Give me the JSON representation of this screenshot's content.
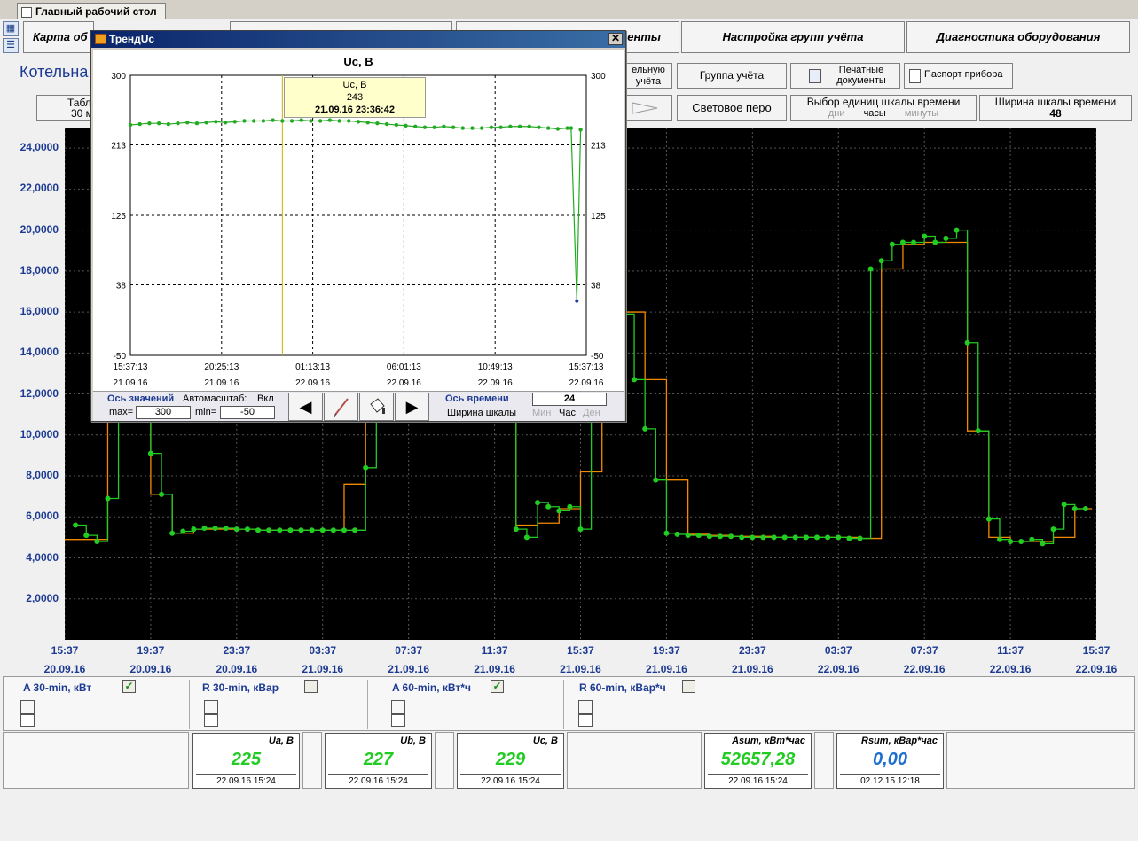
{
  "tab": {
    "title": "Главный рабочий стол"
  },
  "sidebar_icons": [
    "grid-icon",
    "list-icon"
  ],
  "top_buttons": [
    "Карта об",
    "",
    "енты",
    "Настройка групп учёта",
    "Диагностика оборудования"
  ],
  "second_row": {
    "left_partial": "ельную",
    "left_partial2": "учёта",
    "group_btn": "Группа учёта",
    "print_btn": "Печатные документы",
    "passport_btn": "Паспорт прибора"
  },
  "third_row": {
    "table_btn": "Табл",
    "table_btn_sub": "30 м",
    "pen_btn": "Световое перо",
    "units_title": "Выбор единиц шкалы времени",
    "units_days": "дни",
    "units_hours": "часы",
    "units_minutes": "минуты",
    "width_title": "Ширина шкалы времени",
    "width_value": "48"
  },
  "boiler_label": "Котельна",
  "colors": {
    "green": "#22cc22",
    "red": "#ee1111",
    "orange": "#f28a00",
    "cyan": "#22e5ee",
    "accent_blue": "#1c3a92"
  },
  "chart_data": [
    {
      "type": "line",
      "y_ticks": [
        "24,0000",
        "22,0000",
        "20,0000",
        "18,0000",
        "16,0000",
        "14,0000",
        "12,0000",
        "10,0000",
        "8,0000",
        "6,0000",
        "4,0000",
        "2,0000"
      ],
      "ylim": [
        0,
        25000
      ],
      "x_ticks": [
        {
          "time": "15:37",
          "date": "20.09.16"
        },
        {
          "time": "19:37",
          "date": "20.09.16"
        },
        {
          "time": "23:37",
          "date": "20.09.16"
        },
        {
          "time": "03:37",
          "date": "21.09.16"
        },
        {
          "time": "07:37",
          "date": "21.09.16"
        },
        {
          "time": "11:37",
          "date": "21.09.16"
        },
        {
          "time": "15:37",
          "date": "21.09.16"
        },
        {
          "time": "19:37",
          "date": "21.09.16"
        },
        {
          "time": "23:37",
          "date": "21.09.16"
        },
        {
          "time": "03:37",
          "date": "22.09.16"
        },
        {
          "time": "07:37",
          "date": "22.09.16"
        },
        {
          "time": "11:37",
          "date": "22.09.16"
        },
        {
          "time": "15:37",
          "date": "22.09.16"
        }
      ],
      "xlim": [
        0,
        48
      ],
      "grid": true,
      "series": [
        {
          "name": "A 30-min, кВт",
          "color": "#22cc22",
          "x": [
            0.5,
            1.0,
            1.5,
            2.0,
            2.5,
            3.5,
            4.0,
            4.5,
            5.0,
            5.5,
            6.0,
            6.5,
            7.0,
            7.5,
            8.0,
            8.5,
            9.0,
            9.5,
            10.0,
            10.5,
            11.0,
            11.5,
            12.0,
            12.5,
            13.0,
            13.5,
            14.0,
            14.5,
            20.5,
            21.0,
            21.5,
            22.0,
            22.5,
            23.0,
            23.5,
            24.0,
            24.5,
            25.5,
            26.0,
            26.5,
            27.0,
            27.5,
            28.0,
            28.5,
            29.0,
            29.5,
            30.0,
            30.5,
            31.0,
            31.5,
            32.0,
            32.5,
            33.0,
            33.5,
            34.0,
            34.5,
            35.0,
            35.5,
            36.0,
            36.5,
            37.0,
            37.5,
            38.0,
            38.5,
            39.0,
            39.5,
            40.0,
            40.5,
            41.0,
            41.5,
            42.0,
            42.5,
            43.0,
            43.5,
            44.0,
            44.5,
            45.0,
            45.5,
            46.0,
            46.5,
            47.0,
            47.5
          ],
          "values": [
            5600,
            5100,
            4800,
            6900,
            13000,
            13500,
            9100,
            7100,
            5200,
            5300,
            5400,
            5450,
            5450,
            5450,
            5400,
            5400,
            5350,
            5350,
            5350,
            5350,
            5350,
            5350,
            5350,
            5350,
            5350,
            5350,
            8400,
            11500,
            12100,
            5400,
            5000,
            6700,
            6500,
            6300,
            6500,
            5400,
            12000,
            19200,
            15900,
            12700,
            10300,
            7800,
            5200,
            5150,
            5100,
            5100,
            5050,
            5050,
            5050,
            5000,
            5000,
            5000,
            5000,
            5000,
            5000,
            5000,
            5000,
            5000,
            5000,
            4950,
            4950,
            18100,
            18500,
            19300,
            19400,
            19400,
            19700,
            19400,
            19600,
            20000,
            14500,
            10200,
            5900,
            4900,
            4800,
            4800,
            4900,
            4700,
            5400,
            6600,
            6400,
            6400
          ]
        },
        {
          "name": "A 60-min, кВт*ч",
          "color": "#f28a00",
          "x": [
            0.0,
            1.0,
            2.0,
            3.0,
            3.5,
            4.0,
            5.0,
            6.0,
            7.0,
            8.0,
            9.0,
            10.0,
            11.0,
            12.0,
            13.0,
            14.0,
            15.0,
            20.5,
            21.0,
            22.0,
            23.0,
            24.0,
            25.0,
            26.0,
            27.0,
            28.0,
            29.0,
            30.0,
            31.0,
            32.0,
            33.0,
            34.0,
            35.0,
            36.0,
            37.0,
            38.0,
            39.0,
            40.0,
            41.0,
            42.0,
            43.0,
            44.0,
            45.0,
            46.0,
            47.0,
            47.8
          ],
          "values": [
            4900,
            4900,
            11000,
            13000,
            13500,
            7100,
            5200,
            5400,
            5400,
            5400,
            5350,
            5350,
            5350,
            5350,
            7600,
            11500,
            12000,
            11500,
            5600,
            5700,
            6400,
            8200,
            12000,
            16000,
            12700,
            7800,
            5150,
            5100,
            5050,
            5050,
            5000,
            5000,
            5000,
            5000,
            4950,
            18100,
            19300,
            19400,
            19400,
            10200,
            5000,
            4800,
            4800,
            5000,
            6400,
            6400
          ]
        }
      ]
    },
    {
      "type": "line",
      "title": "Uc, В",
      "y_ticks": [
        "300",
        "213",
        "125",
        "38",
        "-50"
      ],
      "ylim": [
        -50,
        300
      ],
      "x_ticks": [
        {
          "time": "15:37:13",
          "date": "21.09.16"
        },
        {
          "time": "20:25:13",
          "date": "21.09.16"
        },
        {
          "time": "01:13:13",
          "date": "22.09.16"
        },
        {
          "time": "06:01:13",
          "date": "22.09.16"
        },
        {
          "time": "10:49:13",
          "date": "22.09.16"
        },
        {
          "time": "15:37:13",
          "date": "22.09.16"
        }
      ],
      "xlim": [
        0,
        24
      ],
      "grid": true,
      "series": [
        {
          "name": "Uc, В",
          "color": "#22aa22",
          "x": [
            0,
            0.5,
            1,
            1.5,
            2,
            2.5,
            3,
            3.5,
            4,
            4.5,
            5,
            5.5,
            6,
            6.5,
            7,
            7.5,
            8,
            8.5,
            9,
            9.5,
            10,
            10.5,
            11,
            11.5,
            12,
            12.5,
            13,
            13.5,
            14,
            14.5,
            15,
            15.5,
            16,
            16.5,
            17,
            17.5,
            18,
            18.5,
            19,
            19.5,
            20,
            20.5,
            21,
            21.5,
            22,
            22.5,
            23,
            23.2,
            23.5,
            23.7
          ],
          "values": [
            238,
            239,
            240,
            240,
            239,
            240,
            241,
            240,
            241,
            242,
            241,
            242,
            243,
            243,
            243,
            244,
            243,
            243,
            244,
            243,
            243,
            244,
            243,
            243,
            242,
            241,
            240,
            239,
            238,
            237,
            236,
            235,
            235,
            236,
            235,
            234,
            234,
            234,
            235,
            235,
            236,
            236,
            236,
            235,
            234,
            233,
            234,
            234,
            18,
            232
          ]
        }
      ],
      "tooltip": {
        "label": "Uc, В",
        "value": "243",
        "datetime": "21.09.16 23:36:42"
      }
    }
  ],
  "trend_window": {
    "title": "ТрендUc",
    "close": "✕",
    "ctrl": {
      "axis_values": "Ось значений",
      "autoscale": "Автомасштаб:",
      "autoscale_val": "Вкл",
      "max_label": "max=",
      "max_val": "300",
      "min_label": "min=",
      "min_val": "-50",
      "prev": "◀",
      "next": "▶",
      "axis_time": "Ось времени",
      "scale_width_label": "Ширина шкалы",
      "scale_width_val": "24",
      "u_min": "Мин",
      "u_hour": "Час",
      "u_day": "Ден"
    }
  },
  "legend": [
    {
      "name": "A 30-min, кВт",
      "checked": true,
      "check_mark": "✓",
      "color": "#22cc22"
    },
    {
      "name": "R 30-min, кВар",
      "checked": false,
      "check_mark": "",
      "color": "#ee1111"
    },
    {
      "name": "A 60-min, кВт*ч",
      "checked": true,
      "check_mark": "✓",
      "color": "#f28a00"
    },
    {
      "name": "R 60-min, кВар*ч",
      "checked": false,
      "check_mark": "",
      "color": "#22e5ee"
    }
  ],
  "values": [
    {
      "title": "Ua, В",
      "value": "225",
      "date": "22.09.16 15:24",
      "color": "#22cc22"
    },
    {
      "title": "Ub, В",
      "value": "227",
      "date": "22.09.16 15:24",
      "color": "#22cc22"
    },
    {
      "title": "Uc, В",
      "value": "229",
      "date": "22.09.16 15:24",
      "color": "#22cc22"
    },
    {
      "title": "Asum, кВт*час",
      "value": "52657,28",
      "date": "22.09.16 15:24",
      "color": "#22cc22"
    },
    {
      "title": "Rsum, кВар*час",
      "value": "0,00",
      "date": "02.12.15 12:18",
      "color": "#1e6fd0"
    }
  ]
}
